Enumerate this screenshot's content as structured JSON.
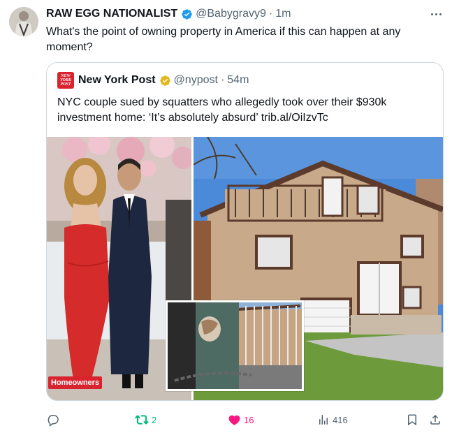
{
  "tweet": {
    "author_name": "RAW EGG NATIONALIST",
    "handle": "@Babygravy9",
    "separator": "·",
    "time": "1m",
    "text": "What's the point of owning property in America if this can happen at any moment?"
  },
  "quote": {
    "logo_lines": [
      "NEW",
      "YORK",
      "POST"
    ],
    "author_name": "New York Post",
    "handle": "@nypost",
    "separator": "·",
    "time": "54m",
    "text": "NYC couple sued by squatters who allegedly took over their $930k investment home: ‘It’s absolutely absurd’ trib.al/OiIzvTc",
    "media_tag": "Homeowners"
  },
  "actions": {
    "replies": "",
    "reposts": "2",
    "likes": "16",
    "views": "416"
  },
  "colors": {
    "verified_blue": "#1d9bf0",
    "verified_gold": "#e2b719",
    "repost_green": "#00ba7c",
    "like_pink": "#f91880",
    "muted": "#536471",
    "nypost_red": "#d9232e"
  },
  "icons": [
    "more-icon",
    "verified-icon",
    "reply-icon",
    "repost-icon",
    "like-icon",
    "views-icon",
    "bookmark-icon",
    "share-icon"
  ]
}
